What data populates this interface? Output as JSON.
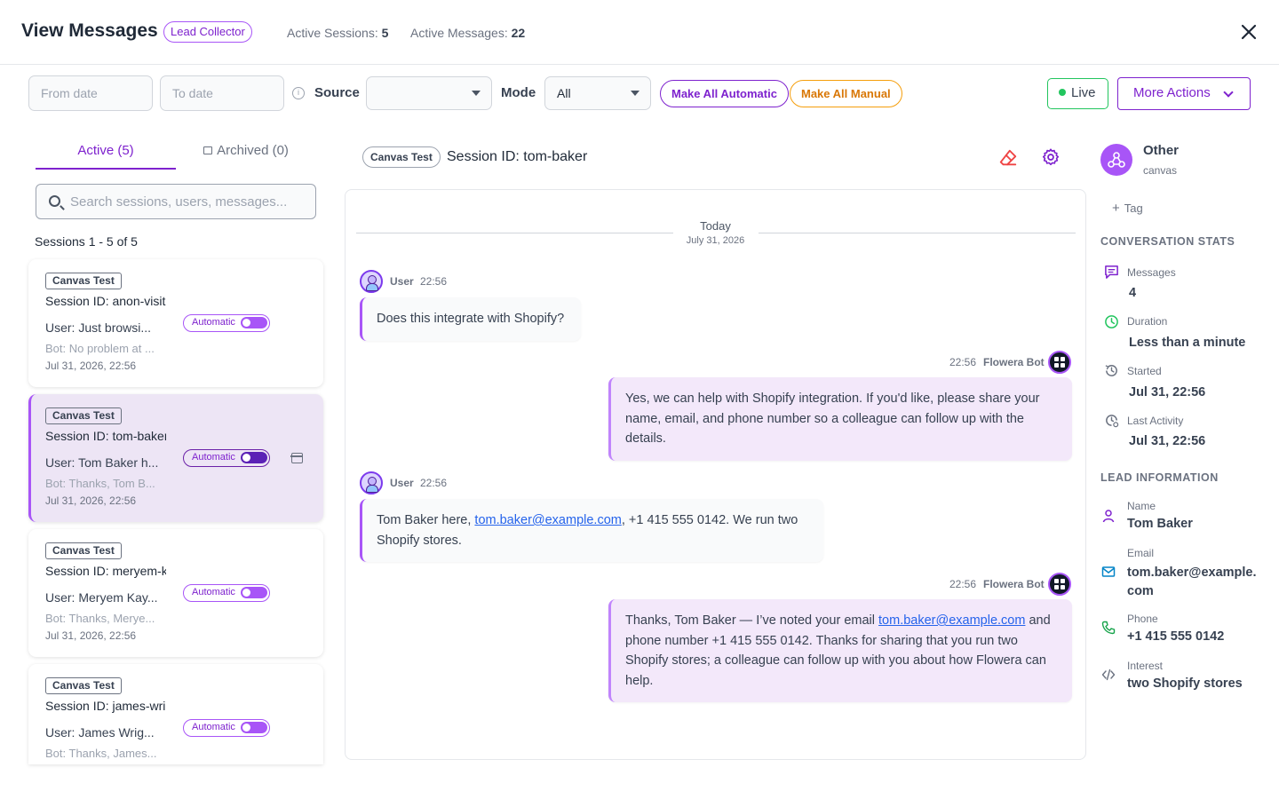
{
  "header": {
    "title": "View Messages",
    "badge": "Lead Collector",
    "active_sessions_label": "Active Sessions:",
    "active_sessions_value": "5",
    "active_messages_label": "Active Messages:",
    "active_messages_value": "22"
  },
  "filters": {
    "from_placeholder": "From date",
    "to_placeholder": "To date",
    "source_label": "Source",
    "source_value": "",
    "mode_label": "Mode",
    "mode_value": "All",
    "make_all_automatic": "Make All Automatic",
    "make_all_manual": "Make All Manual",
    "live": "Live",
    "more_actions": "More Actions"
  },
  "sidebar": {
    "tab_active": "Active (5)",
    "tab_archived": "Archived (0)",
    "search_placeholder": "Search sessions, users, messages...",
    "count_text": "Sessions 1 - 5 of 5",
    "sessions": [
      {
        "tag": "Canvas Test",
        "session": "Session ID: anon-visit",
        "user": "User: Just browsi...",
        "bot": "Bot: No problem at ...",
        "date": "Jul 31, 2026, 22:56",
        "mode": "Automatic"
      },
      {
        "tag": "Canvas Test",
        "session": "Session ID: tom-baker",
        "user": "User: Tom Baker h...",
        "bot": "Bot: Thanks, Tom B...",
        "date": "Jul 31, 2026, 22:56",
        "mode": "Automatic"
      },
      {
        "tag": "Canvas Test",
        "session": "Session ID: meryem-k",
        "user": "User: Meryem Kay...",
        "bot": "Bot: Thanks, Merye...",
        "date": "Jul 31, 2026, 22:56",
        "mode": "Automatic"
      },
      {
        "tag": "Canvas Test",
        "session": "Session ID: james-wri",
        "user": "User: James Wrig...",
        "bot": "Bot: Thanks, James...",
        "date": "",
        "mode": "Automatic"
      }
    ]
  },
  "chat": {
    "tag": "Canvas Test",
    "session_title": "Session ID: tom-baker",
    "day_label": "Today",
    "day_date": "July 31, 2026",
    "messages": [
      {
        "sender": "User",
        "time": "22:56",
        "text": "Does this integrate with Shopify?"
      },
      {
        "sender": "Flowera Bot",
        "time": "22:56",
        "text": "Yes, we can help with Shopify integration. If you'd like, please share your name, email, and phone number so a colleague can follow up with the details."
      },
      {
        "sender": "User",
        "time": "22:56",
        "text_before": "Tom Baker here, ",
        "link": "tom.baker@example.com",
        "text_after": ", +1 415 555 0142. We run two Shopify stores."
      },
      {
        "sender": "Flowera Bot",
        "time": "22:56",
        "text_before": "Thanks, Tom Baker — I’ve noted your email ",
        "link": "tom.baker@example.com",
        "text_after": " and phone number +1 415 555 0142. Thanks for sharing that you run two Shopify stores; a colleague can follow up with you about how Flowera can help."
      }
    ]
  },
  "details": {
    "source_name": "Other",
    "source_sub": "canvas",
    "tag_label": "Tag",
    "stats_heading": "CONVERSATION STATS",
    "stats": [
      {
        "label": "Messages",
        "value": "4",
        "icon": "message-icon"
      },
      {
        "label": "Duration",
        "value": "Less than a minute",
        "icon": "clock-icon"
      },
      {
        "label": "Started",
        "value": "Jul 31, 22:56",
        "icon": "history-icon"
      },
      {
        "label": "Last Activity",
        "value": "Jul 31, 22:56",
        "icon": "clock-refresh-icon"
      }
    ],
    "lead_heading": "LEAD INFORMATION",
    "lead": [
      {
        "label": "Name",
        "value": "Tom Baker",
        "icon": "user-icon"
      },
      {
        "label": "Email",
        "value": "tom.baker@example.com",
        "icon": "mail-icon"
      },
      {
        "label": "Phone",
        "value": "+1 415 555 0142",
        "icon": "phone-icon"
      },
      {
        "label": "Interest",
        "value": "two Shopify stores",
        "icon": "code-icon"
      }
    ]
  },
  "colors": {
    "accent": "#7e22ce",
    "live": "#22c55e",
    "manual": "#d97706",
    "selected_card": "#ede5f5"
  }
}
